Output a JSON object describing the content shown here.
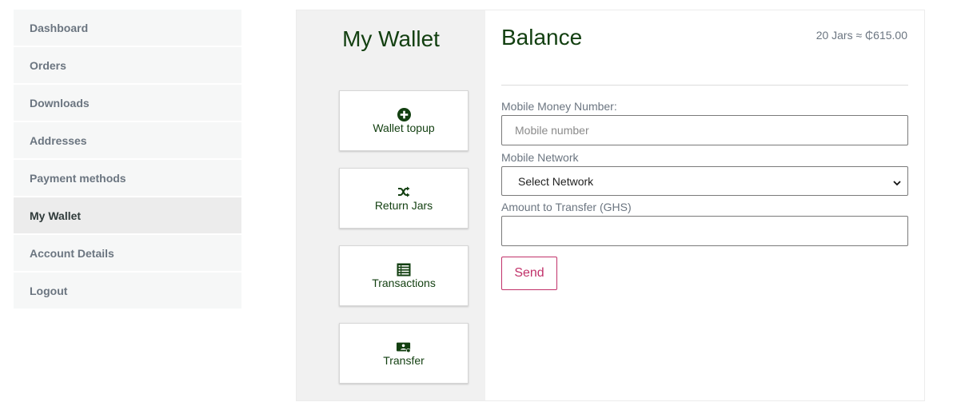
{
  "nav": {
    "items": [
      {
        "label": "Dashboard",
        "active": false
      },
      {
        "label": "Orders",
        "active": false
      },
      {
        "label": "Downloads",
        "active": false
      },
      {
        "label": "Addresses",
        "active": false
      },
      {
        "label": "Payment methods",
        "active": false
      },
      {
        "label": "My Wallet",
        "active": true
      },
      {
        "label": "Account Details",
        "active": false
      },
      {
        "label": "Logout",
        "active": false
      }
    ]
  },
  "wallet": {
    "title": "My Wallet",
    "buttons": [
      {
        "label": "Wallet topup",
        "icon": "plus-circle-icon"
      },
      {
        "label": "Return Jars",
        "icon": "shuffle-icon"
      },
      {
        "label": "Transactions",
        "icon": "list-table-icon"
      },
      {
        "label": "Transfer",
        "icon": "money-transfer-icon"
      }
    ]
  },
  "balance": {
    "title": "Balance",
    "summary": "20 Jars ≈ ₵615.00"
  },
  "form": {
    "mobile_label": "Mobile Money Number:",
    "mobile_placeholder": "Mobile number",
    "network_label": "Mobile Network",
    "network_selected": "Select Network",
    "amount_label": "Amount to Transfer (GHS)",
    "amount_value": "",
    "send_label": "Send"
  },
  "colors": {
    "brand_green": "#123f10",
    "send_accent": "#c1326a",
    "muted_text": "#6b7580"
  }
}
